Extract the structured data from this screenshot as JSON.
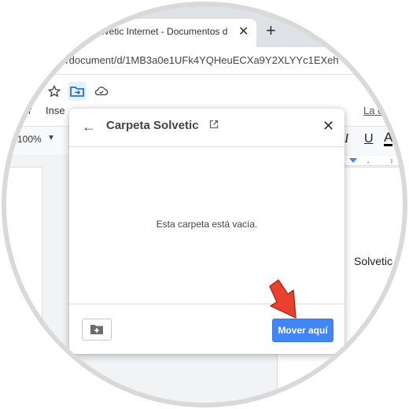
{
  "browser": {
    "tab_title": "lvetic Internet - Documentos d",
    "url": "/document/d/1MB3a0e1UFk4YQHeuECXa9Y2XLYYc1EXeh"
  },
  "docs": {
    "menus": [
      "r",
      "Inse"
    ],
    "menu_right": "La c",
    "zoom": "100%",
    "doc_text": "Solvetic"
  },
  "dialog": {
    "title": "Carpeta Solvetic",
    "empty_message": "Esta carpeta está vacía.",
    "move_button": "Mover aquí"
  },
  "colors": {
    "primary_button": "#4285f4",
    "arrow": "#e8412e"
  }
}
